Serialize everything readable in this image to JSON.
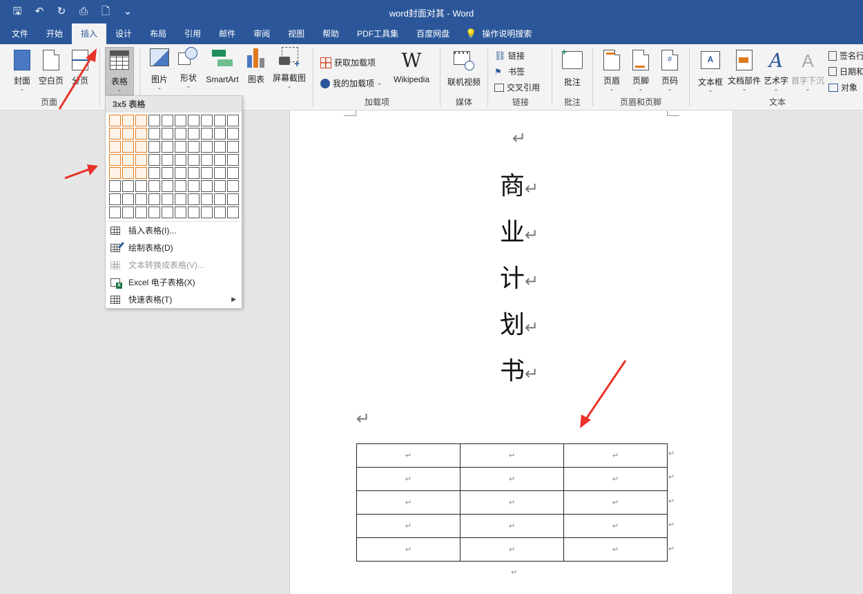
{
  "titlebar": {
    "title": "word封面对其 - Word",
    "qat": [
      {
        "icon": "save-icon",
        "glyph": "🖫"
      },
      {
        "icon": "undo-icon",
        "glyph": "↶"
      },
      {
        "icon": "redo-icon",
        "glyph": "↻"
      },
      {
        "icon": "print-preview-icon",
        "glyph": "⎙"
      },
      {
        "icon": "new-document-icon",
        "glyph": "🗋"
      },
      {
        "icon": "customize-qat-icon",
        "glyph": "⌄"
      }
    ]
  },
  "tabs": [
    "文件",
    "开始",
    "插入",
    "设计",
    "布局",
    "引用",
    "邮件",
    "审阅",
    "视图",
    "帮助",
    "PDF工具集",
    "百度网盘"
  ],
  "active_tab": "插入",
  "search_tab": "操作说明搜索",
  "ribbon": {
    "groups": {
      "pages": "页面",
      "addins": "加载项",
      "media": "媒体",
      "links": "链接",
      "comments": "批注",
      "header_footer": "页眉和页脚",
      "text": "文本"
    },
    "buttons": {
      "cover": "封面",
      "blank_page": "空白页",
      "page_break": "分页",
      "table": "表格",
      "picture": "图片",
      "shapes": "形状",
      "smartart": "SmartArt",
      "chart": "图表",
      "screenshot": "屏幕截图",
      "get_addins": "获取加载项",
      "my_addins": "我的加载项",
      "wikipedia": "Wikipedia",
      "wikipedia_logo": "W",
      "online_video": "联机视频",
      "link": "链接",
      "bookmark": "书签",
      "cross_ref": "交叉引用",
      "comment": "批注",
      "header": "页眉",
      "footer": "页脚",
      "page_number": "页码",
      "textbox": "文本框",
      "quick_parts": "文档部件",
      "wordart": "艺术字",
      "dropcap": "首字下沉",
      "signature": "签名行",
      "datetime": "日期和",
      "object": "对象"
    }
  },
  "dropdown": {
    "header": "3x5 表格",
    "grid_cols": 10,
    "grid_rows": 8,
    "selected_cols": 3,
    "selected_rows": 5,
    "highlight_color": "#e07a1f",
    "items": [
      {
        "label": "插入表格(I)...",
        "icon": "insert-table-icon",
        "enabled": true
      },
      {
        "label": "绘制表格(D)",
        "icon": "draw-table-icon",
        "enabled": true
      },
      {
        "label": "文本转换成表格(V)...",
        "icon": "text-to-table-icon",
        "enabled": false
      },
      {
        "label": "Excel 电子表格(X)",
        "icon": "excel-table-icon",
        "enabled": true
      },
      {
        "label": "快速表格(T)",
        "icon": "quick-table-icon",
        "enabled": true,
        "submenu": true
      }
    ]
  },
  "document": {
    "paragraph_mark": "↵",
    "title_chars": [
      "商",
      "业",
      "计",
      "划",
      "书"
    ],
    "table_rows": 5,
    "table_cols": 3
  },
  "colors": {
    "word_blue": "#2b579a",
    "ribbon_bg": "#f3f3f3",
    "annotation_red": "#e8332a"
  }
}
